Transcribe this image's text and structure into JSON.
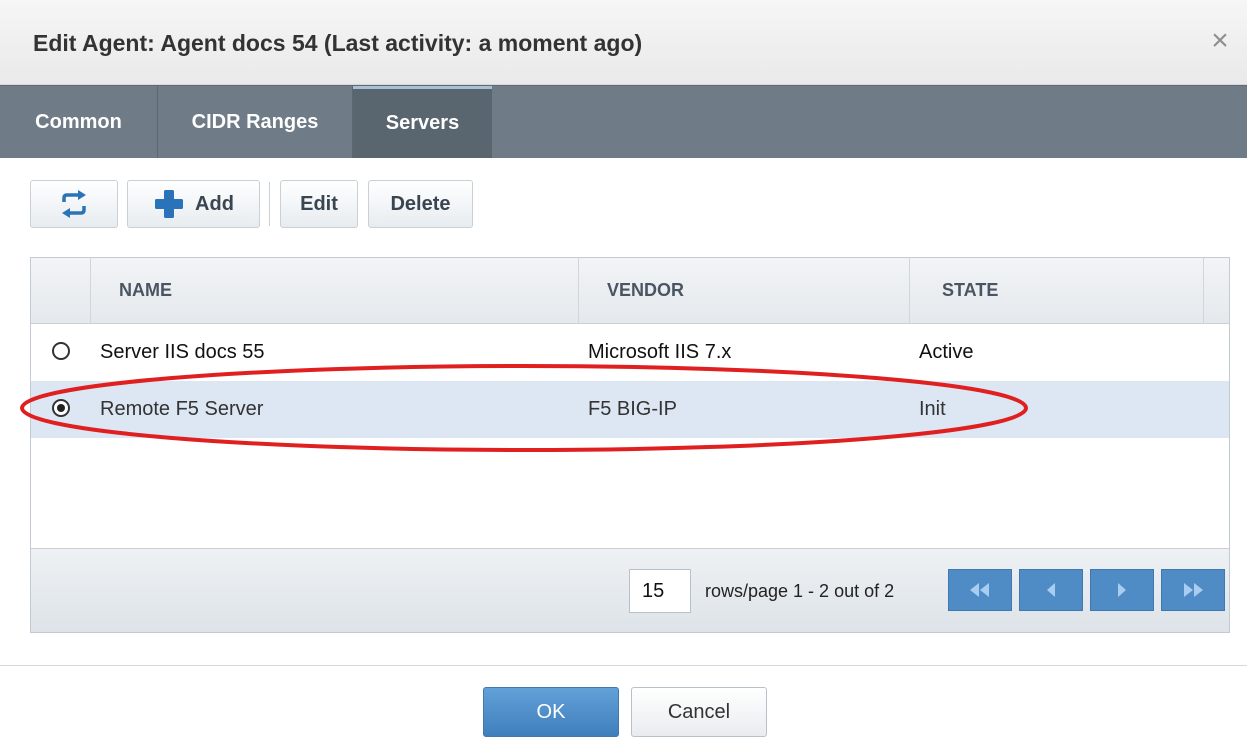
{
  "dialog": {
    "title": "Edit Agent: Agent docs 54 (Last activity: a moment ago)",
    "close_icon": "×"
  },
  "tabs": [
    {
      "label": "Common",
      "active": false
    },
    {
      "label": "CIDR Ranges",
      "active": false
    },
    {
      "label": "Servers",
      "active": true
    }
  ],
  "toolbar": {
    "refresh_icon": "refresh-icon",
    "add_label": "Add",
    "edit_label": "Edit",
    "delete_label": "Delete"
  },
  "grid": {
    "columns": [
      "NAME",
      "VENDOR",
      "STATE"
    ],
    "rows": [
      {
        "name": "Server IIS docs 55",
        "vendor": "Microsoft IIS 7.x",
        "state": "Active",
        "selected": false
      },
      {
        "name": "Remote F5 Server",
        "vendor": "F5 BIG-IP",
        "state": "Init",
        "selected": true
      }
    ]
  },
  "pager": {
    "rows_per_page": "15",
    "rows_label": "rows/page  1 - 2 out of 2"
  },
  "footer": {
    "ok_label": "OK",
    "cancel_label": "Cancel"
  },
  "colors": {
    "tab_bar": "#6f7b87",
    "selected_row": "#dce7f3",
    "accent": "#4f8cc6",
    "annotation": "#e02020"
  }
}
